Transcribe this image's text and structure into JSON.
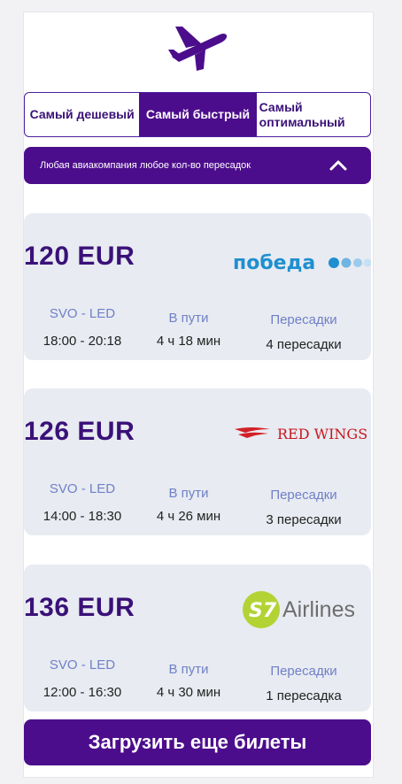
{
  "tabs": [
    {
      "label": "Самый дешевый"
    },
    {
      "label": "Самый быстрый"
    },
    {
      "label": "Самый оптимальный"
    }
  ],
  "filter": {
    "label": "Любая авиакомпания любое кол-во пересадок",
    "icon": "chevron-up-icon"
  },
  "labels": {
    "travel": "В пути",
    "transfers": "Пересадки"
  },
  "tickets": [
    {
      "price": "120 EUR",
      "airline": "победа",
      "route": "SVO - LED",
      "time": "18:00 - 20:18",
      "duration": "4 ч 18 мин",
      "stops": "4 пересадки"
    },
    {
      "price": "126 EUR",
      "airline": "RED WINGS",
      "route": "SVO - LED",
      "time": "14:00 - 18:30",
      "duration": "4 ч 26 мин",
      "stops": "3 пересадки"
    },
    {
      "price": "136 EUR",
      "airline": "Airlines",
      "route": "SVO - LED",
      "time": "12:00 - 16:30",
      "duration": "4 ч 30 мин",
      "stops": "1 пересадка"
    }
  ],
  "load_more": "Загрузить еще билеты",
  "colors": {
    "accent": "#4c0d8c",
    "card": "#e8ebf1",
    "label": "#6f80c8"
  }
}
